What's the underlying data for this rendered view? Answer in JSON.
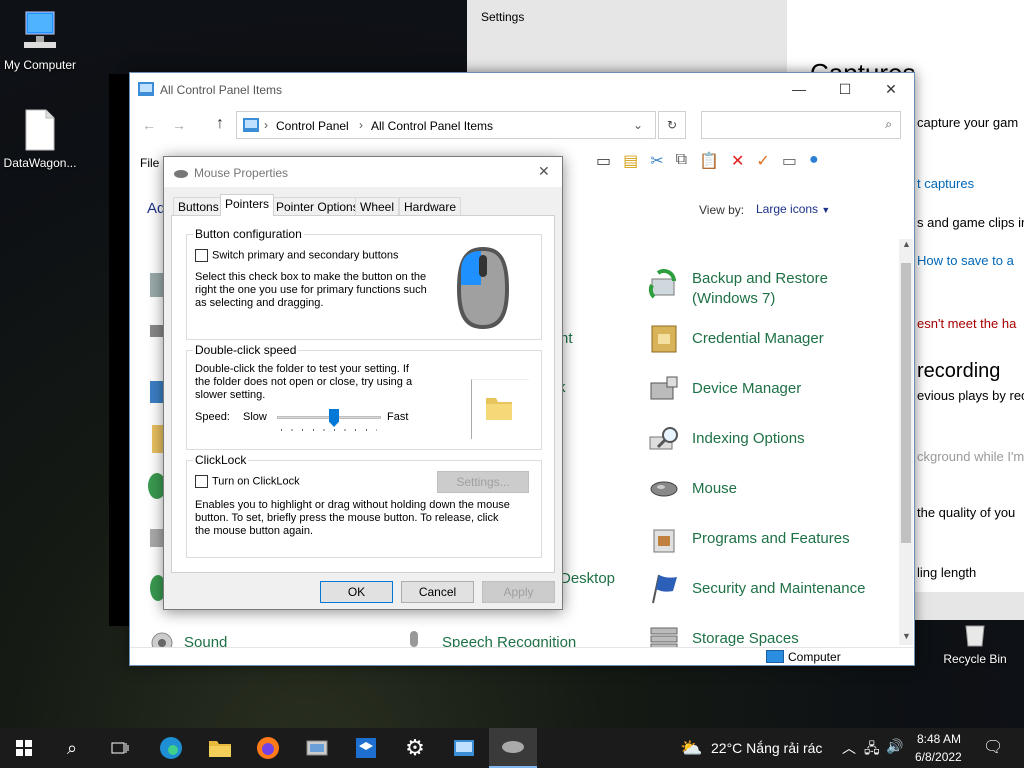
{
  "desktop": {
    "icons": [
      {
        "label": "My Computer"
      },
      {
        "label": "DataWagon..."
      },
      {
        "label": "Recycle Bin"
      }
    ]
  },
  "settings_window": {
    "title": "Settings",
    "heading_partial": "Captures",
    "lines": [
      "capture your gam",
      "t captures",
      "s and game clips in",
      "How to save to a",
      "esn't meet the ha",
      "recording",
      "evious plays by rec",
      "ckground while I'm",
      "the quality of you",
      "ling length"
    ]
  },
  "control_panel": {
    "title": "All Control Panel Items",
    "breadcrumb": [
      "Control Panel",
      "All Control Panel Items"
    ],
    "menu_file": "File",
    "adjust_partial": "Ad",
    "view_by_label": "View by:",
    "view_by_value": "Large icons",
    "items_right": [
      {
        "label": "Backup and Restore (Windows 7)",
        "icon": "backup-icon"
      },
      {
        "label": "Credential Manager",
        "icon": "credential-icon"
      },
      {
        "label": "Device Manager",
        "icon": "device-manager-icon"
      },
      {
        "label": "Indexing Options",
        "icon": "indexing-icon"
      },
      {
        "label": "Mouse",
        "icon": "mouse-icon"
      },
      {
        "label": "Programs and Features",
        "icon": "programs-icon"
      },
      {
        "label": "Security and Maintenance",
        "icon": "security-flag-icon"
      },
      {
        "label": "Storage Spaces",
        "icon": "storage-icon"
      }
    ],
    "items_partial": [
      {
        "label": "nt"
      },
      {
        "label": "Desktop"
      },
      {
        "label": "Sound"
      },
      {
        "label": "Speech Recognition"
      }
    ],
    "status_computer": "Computer"
  },
  "mouse_properties": {
    "title": "Mouse Properties",
    "tabs": [
      "Buttons",
      "Pointers",
      "Pointer Options",
      "Wheel",
      "Hardware"
    ],
    "active_tab": "Pointers",
    "button_config": {
      "title": "Button configuration",
      "checkbox_label": "Switch primary and secondary buttons",
      "description": "Select this check box to make the button on the right the one you use for primary functions such as selecting and dragging."
    },
    "double_click": {
      "title": "Double-click speed",
      "description": "Double-click the folder to test your setting. If the folder does not open or close, try using a slower setting.",
      "speed_label": "Speed:",
      "slow_label": "Slow",
      "fast_label": "Fast",
      "slider_fraction": 0.55
    },
    "clicklock": {
      "title": "ClickLock",
      "checkbox_label": "Turn on ClickLock",
      "settings_button": "Settings...",
      "description": "Enables you to highlight or drag without holding down the mouse button. To set, briefly press the mouse button. To release, click the mouse button again."
    },
    "ok": "OK",
    "cancel": "Cancel",
    "apply": "Apply"
  },
  "taskbar": {
    "weather": "22°C  Nắng rải rác",
    "time": "8:48 AM",
    "date": "6/8/2022"
  },
  "colors": {
    "cp_link_green": "#1e7145",
    "taskbar_bg": "#1b1b1b",
    "accent_blue": "#0078d7"
  }
}
